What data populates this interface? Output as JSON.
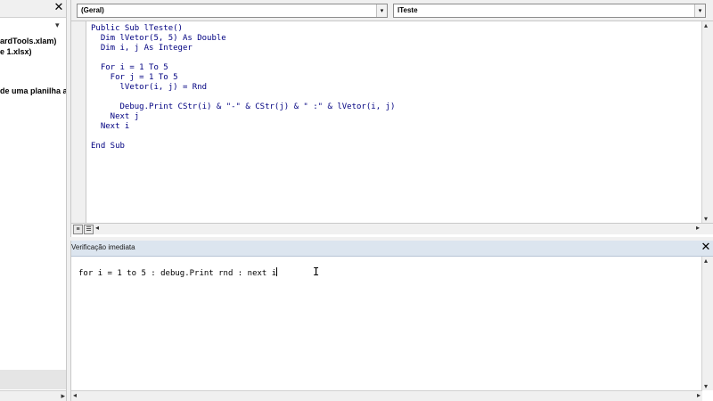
{
  "project_panel": {
    "close_glyph": "✕",
    "dropdown_glyph": "▾",
    "tree": [
      "ardTools.xlam)",
      "e 1.xlsx)",
      "de uma planilha aut"
    ],
    "scroll_right_glyph": "▸"
  },
  "code_window": {
    "object_combo": "(Geral)",
    "procedure_combo": "lTeste",
    "combo_arrow": "▾",
    "lines": [
      "Public Sub lTeste()",
      "  Dim lVetor(5, 5) As Double",
      "  Dim i, j As Integer",
      "",
      "  For i = 1 To 5",
      "    For j = 1 To 5",
      "      lVetor(i, j) = Rnd",
      "",
      "      Debug.Print CStr(i) & \"-\" & CStr(j) & \" :\" & lVetor(i, j)",
      "    Next j",
      "  Next i",
      "",
      "End Sub"
    ],
    "view_procedure_glyph": "≡",
    "view_module_glyph": "☰",
    "scroll_left_glyph": "◂",
    "scroll_right_glyph": "▸",
    "scroll_up_glyph": "▴",
    "scroll_down_glyph": "▾"
  },
  "immediate_window": {
    "title": "Verificação imediata",
    "close_glyph": "✕",
    "input_text": "for i = 1 to 5 : debug.Print rnd : next i",
    "ibeam_glyph": "I",
    "scroll_up_glyph": "▴",
    "scroll_down_glyph": "▾",
    "scroll_left_glyph": "◂",
    "scroll_right_glyph": "▸"
  },
  "colors": {
    "code_text": "#000080",
    "immediate_title_bg": "#dce5ef",
    "editor_bg": "#ffffff",
    "chrome_bg": "#f0f0f0"
  }
}
